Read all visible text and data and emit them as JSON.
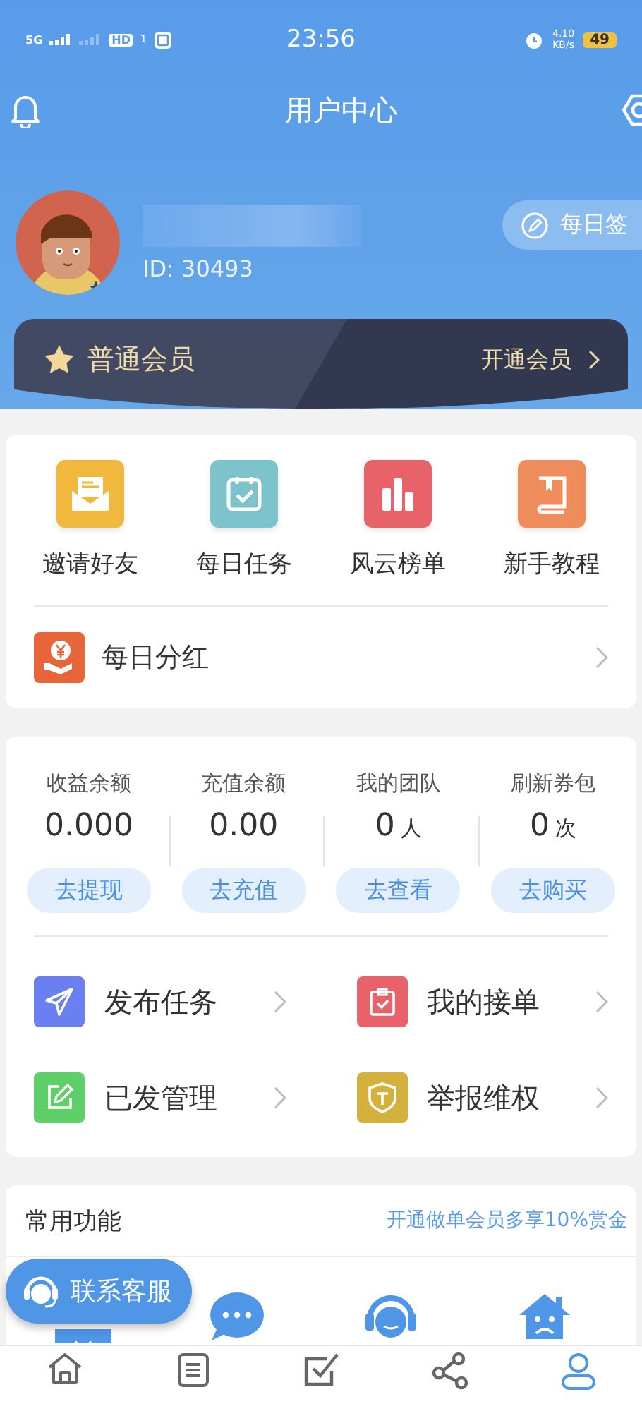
{
  "status_bar": {
    "network": "5G",
    "hd": "HD",
    "sim": "1",
    "time": "23:56",
    "speed": "4.10",
    "speed_unit": "KB/s",
    "battery": "49"
  },
  "header": {
    "title": "用户中心"
  },
  "profile": {
    "user_id": "ID: 30493",
    "checkin_button": "每日签"
  },
  "membership": {
    "level": "普通会员",
    "upgrade": "开通会员"
  },
  "shortcuts": [
    {
      "label": "邀请好友",
      "kind": "invite",
      "color": "#f0b83c"
    },
    {
      "label": "每日任务",
      "kind": "calendar",
      "color": "#7cc3cb"
    },
    {
      "label": "风云榜单",
      "kind": "chart",
      "color": "#e8626a"
    },
    {
      "label": "新手教程",
      "kind": "book",
      "color": "#ee8c5c"
    }
  ],
  "dividend": {
    "label": "每日分红"
  },
  "stats": [
    {
      "label": "收益余额",
      "value": "0.000",
      "button": "去提现"
    },
    {
      "label": "充值余额",
      "value": "0.00",
      "button": "去充值"
    },
    {
      "label": "我的团队",
      "value": "0",
      "unit": "人",
      "button": "去查看"
    },
    {
      "label": "刷新券包",
      "value": "0",
      "unit": "次",
      "button": "去购买"
    }
  ],
  "actions": [
    {
      "label": "发布任务",
      "kind": "send",
      "color": "#6a7ff0"
    },
    {
      "label": "我的接单",
      "kind": "clipboard",
      "color": "#e8626a"
    },
    {
      "label": "已发管理",
      "kind": "edit",
      "color": "#5fcf6a"
    },
    {
      "label": "举报维权",
      "kind": "shield",
      "color": "#d4b03c"
    }
  ],
  "common": {
    "title": "常用功能",
    "promo": "开通做单会员多享10%赏金",
    "contact_button": "联系客服"
  },
  "tab_bar": [
    {
      "kind": "home",
      "selected": false
    },
    {
      "kind": "list",
      "selected": false
    },
    {
      "kind": "check",
      "selected": false
    },
    {
      "kind": "share",
      "selected": false
    },
    {
      "kind": "user",
      "selected": true
    }
  ]
}
